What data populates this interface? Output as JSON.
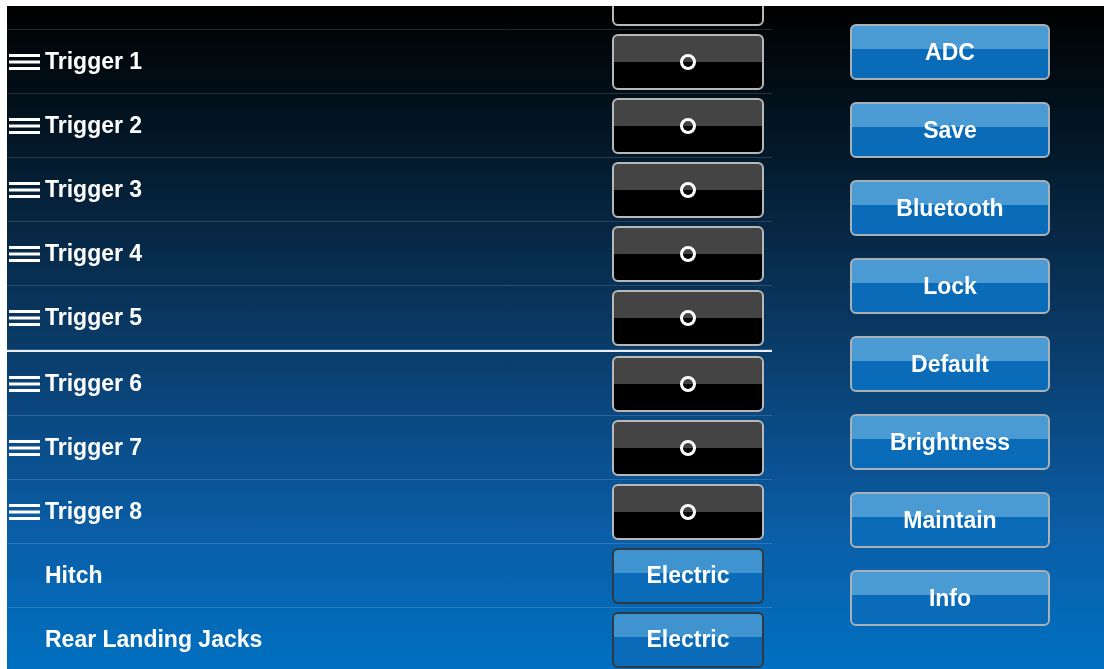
{
  "rows": [
    {
      "kind": "toggle",
      "on": false
    },
    {
      "kind": "toggle",
      "label": "Trigger 1",
      "draggable": true,
      "on": false
    },
    {
      "kind": "toggle",
      "label": "Trigger 2",
      "draggable": true,
      "on": false
    },
    {
      "kind": "toggle",
      "label": "Trigger 3",
      "draggable": true,
      "on": false
    },
    {
      "kind": "toggle",
      "label": "Trigger 4",
      "draggable": true,
      "on": false
    },
    {
      "kind": "toggle",
      "label": "Trigger 5",
      "draggable": true,
      "on": false
    },
    {
      "kind": "separator"
    },
    {
      "kind": "toggle",
      "label": "Trigger 6",
      "draggable": true,
      "on": false
    },
    {
      "kind": "toggle",
      "label": "Trigger 7",
      "draggable": true,
      "on": false
    },
    {
      "kind": "toggle",
      "label": "Trigger 8",
      "draggable": true,
      "on": false
    },
    {
      "kind": "select",
      "label": "Hitch",
      "draggable": false,
      "value": "Electric"
    },
    {
      "kind": "select",
      "label": "Rear Landing Jacks",
      "draggable": false,
      "value": "Electric"
    }
  ],
  "buttons": [
    "ADC",
    "Save",
    "Bluetooth",
    "Lock",
    "Default",
    "Brightness",
    "Maintain",
    "Info"
  ]
}
